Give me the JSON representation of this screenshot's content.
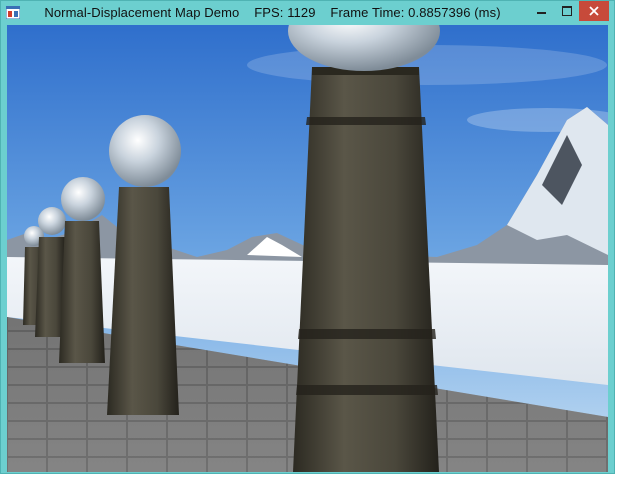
{
  "window": {
    "app_name": "Normal-Displacement Map Demo",
    "fps_label": "FPS: 1129",
    "frame_time_label": "Frame Time: 0.8857396 (ms)"
  },
  "controls": {
    "minimize_icon": "minimize-icon",
    "maximize_icon": "maximize-icon",
    "close_icon": "close-icon"
  },
  "scene": {
    "description_icon": "3d-render-viewport"
  },
  "colors": {
    "title_bar": "#6ccfcf",
    "close_button": "#c74a3a"
  }
}
